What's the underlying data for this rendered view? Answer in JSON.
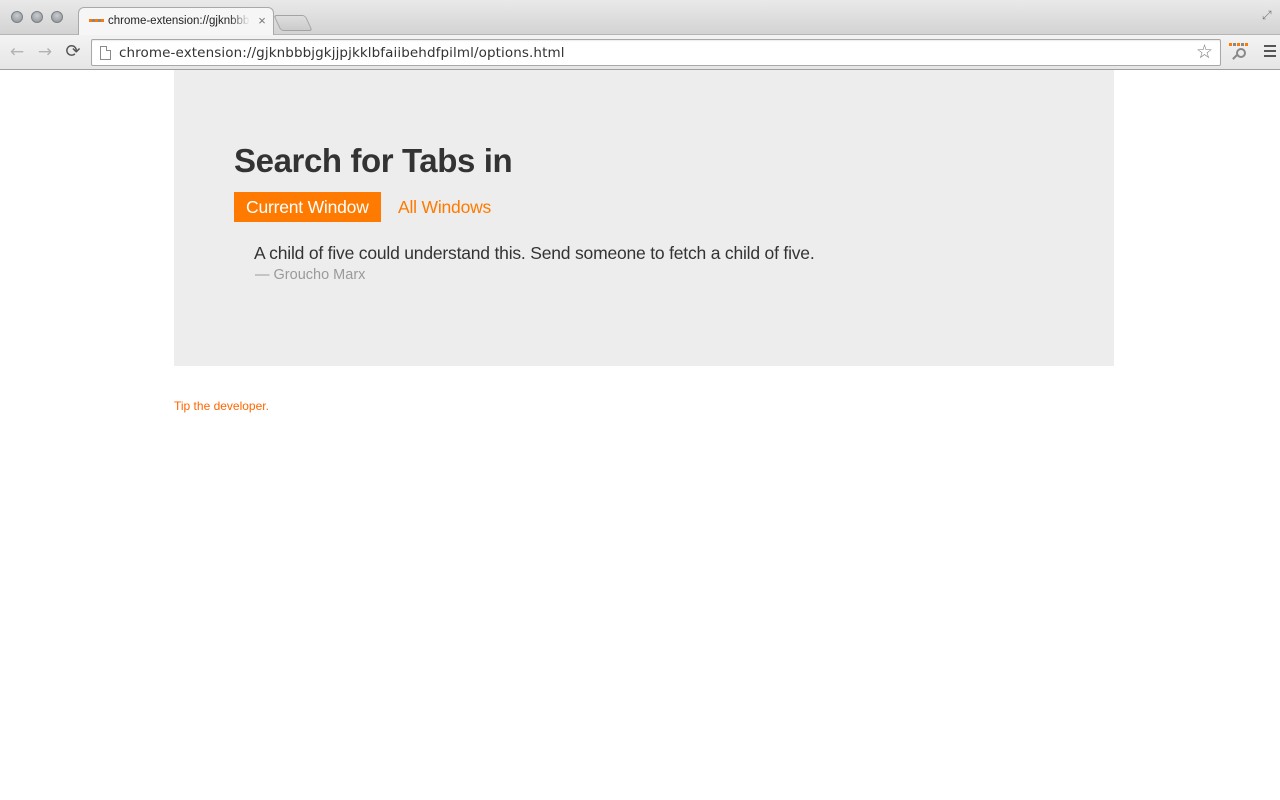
{
  "browser": {
    "tab_title": "chrome-extension://gjknbbbjgkjjpjkklbfaiibehdfpilml/options.html",
    "tab_close_glyph": "×",
    "url": "chrome-extension://gjknbbbjgkjjpjkklbfaiibehdfpilml/options.html",
    "icons": {
      "back": "arrow-left",
      "forward": "arrow-right",
      "reload": "reload",
      "bookmark": "star-outline",
      "extension": "tab-search-extension",
      "menu": "hamburger-menu"
    }
  },
  "options_page": {
    "heading": "Search for Tabs in",
    "scope_options": [
      {
        "label": "Current Window",
        "selected": true
      },
      {
        "label": "All Windows",
        "selected": false
      }
    ],
    "quote": "A child of five could understand this. Send someone to fetch a child of five.",
    "quote_author": "— Groucho Marx"
  },
  "footer": {
    "tip_link": "Tip the developer."
  },
  "colors": {
    "accent": "#ff7a00",
    "panel_background": "#ededed",
    "heading_text": "#333333",
    "muted_text": "#9a9a9a",
    "favicon_squares": [
      "#ff7a00",
      "#888888",
      "#ff7a00",
      "#888888",
      "#ff7a00"
    ]
  }
}
